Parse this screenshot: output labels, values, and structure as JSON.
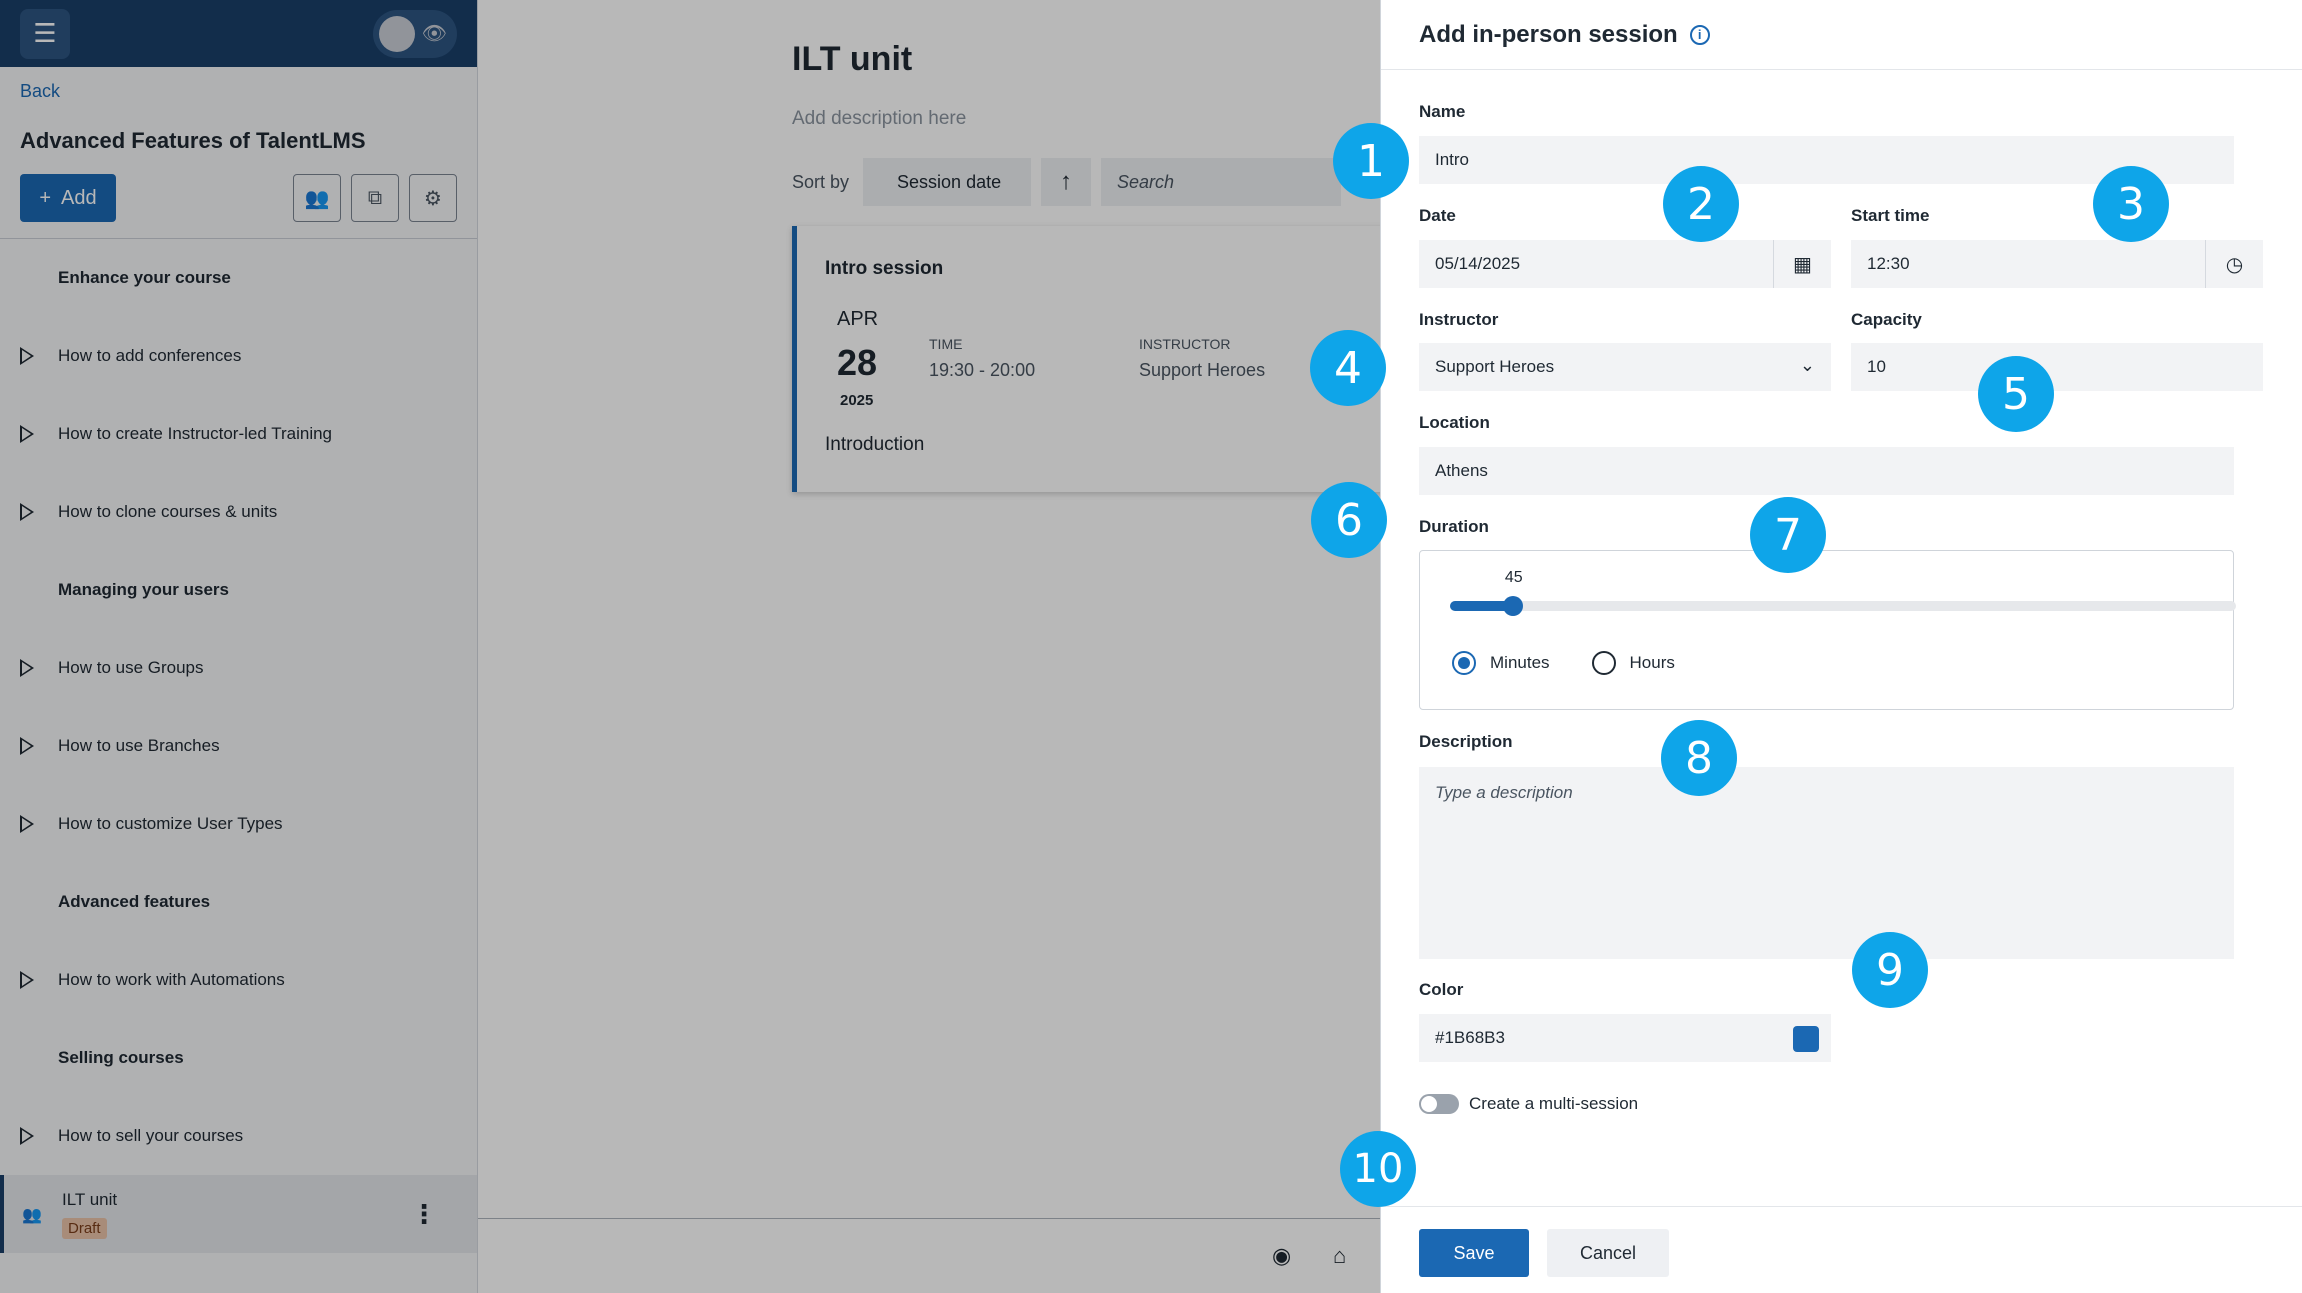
{
  "sidebar": {
    "back_label": "Back",
    "course_title": "Advanced Features of TalentLMS",
    "add_label": "Add",
    "items": [
      {
        "type": "section",
        "label": "Enhance your course"
      },
      {
        "type": "unit",
        "label": "How to add conferences"
      },
      {
        "type": "unit",
        "label": "How to create Instructor-led Training"
      },
      {
        "type": "unit",
        "label": "How to clone courses & units"
      },
      {
        "type": "section",
        "label": "Managing your users"
      },
      {
        "type": "unit",
        "label": "How to use Groups"
      },
      {
        "type": "unit",
        "label": "How to use Branches"
      },
      {
        "type": "unit",
        "label": "How to customize User Types"
      },
      {
        "type": "section",
        "label": "Advanced features"
      },
      {
        "type": "unit",
        "label": "How to work with Automations"
      },
      {
        "type": "section",
        "label": "Selling courses"
      },
      {
        "type": "unit",
        "label": "How to sell your courses"
      }
    ],
    "active_item": {
      "label": "ILT unit",
      "badge": "Draft"
    }
  },
  "main": {
    "unit_title": "ILT unit",
    "description_placeholder": "Add description here",
    "sort_label": "Sort by",
    "sort_value": "Session date",
    "search_placeholder": "Search",
    "session_card": {
      "title": "Intro session",
      "month": "APR",
      "day": "28",
      "year": "2025",
      "time_label": "TIME",
      "time_value": "19:30 - 20:00",
      "instructor_label": "INSTRUCTOR",
      "instructor_value": "Support Heroes",
      "description": "Introduction"
    }
  },
  "drawer": {
    "title": "Add in-person session",
    "name_label": "Name",
    "name_value": "Intro",
    "date_label": "Date",
    "date_value": "05/14/2025",
    "start_time_label": "Start time",
    "start_time_value": "12:30",
    "instructor_label": "Instructor",
    "instructor_value": "Support Heroes",
    "capacity_label": "Capacity",
    "capacity_value": "10",
    "location_label": "Location",
    "location_value": "Athens",
    "duration_label": "Duration",
    "duration_value": "45",
    "duration_fraction": 0.08,
    "unit_minutes": "Minutes",
    "unit_hours": "Hours",
    "description_label": "Description",
    "description_placeholder": "Type a description",
    "color_label": "Color",
    "color_value": "#1B68B3",
    "multi_session_label": "Create a multi-session",
    "save_label": "Save",
    "cancel_label": "Cancel"
  },
  "callouts": [
    "1",
    "2",
    "3",
    "4",
    "5",
    "6",
    "7",
    "8",
    "9",
    "10"
  ],
  "colors": {
    "brand_dark": "#1a3f68",
    "accent": "#1b68b3",
    "callout": "#0ea5e9",
    "draft_badge": "#e9c2a8"
  }
}
